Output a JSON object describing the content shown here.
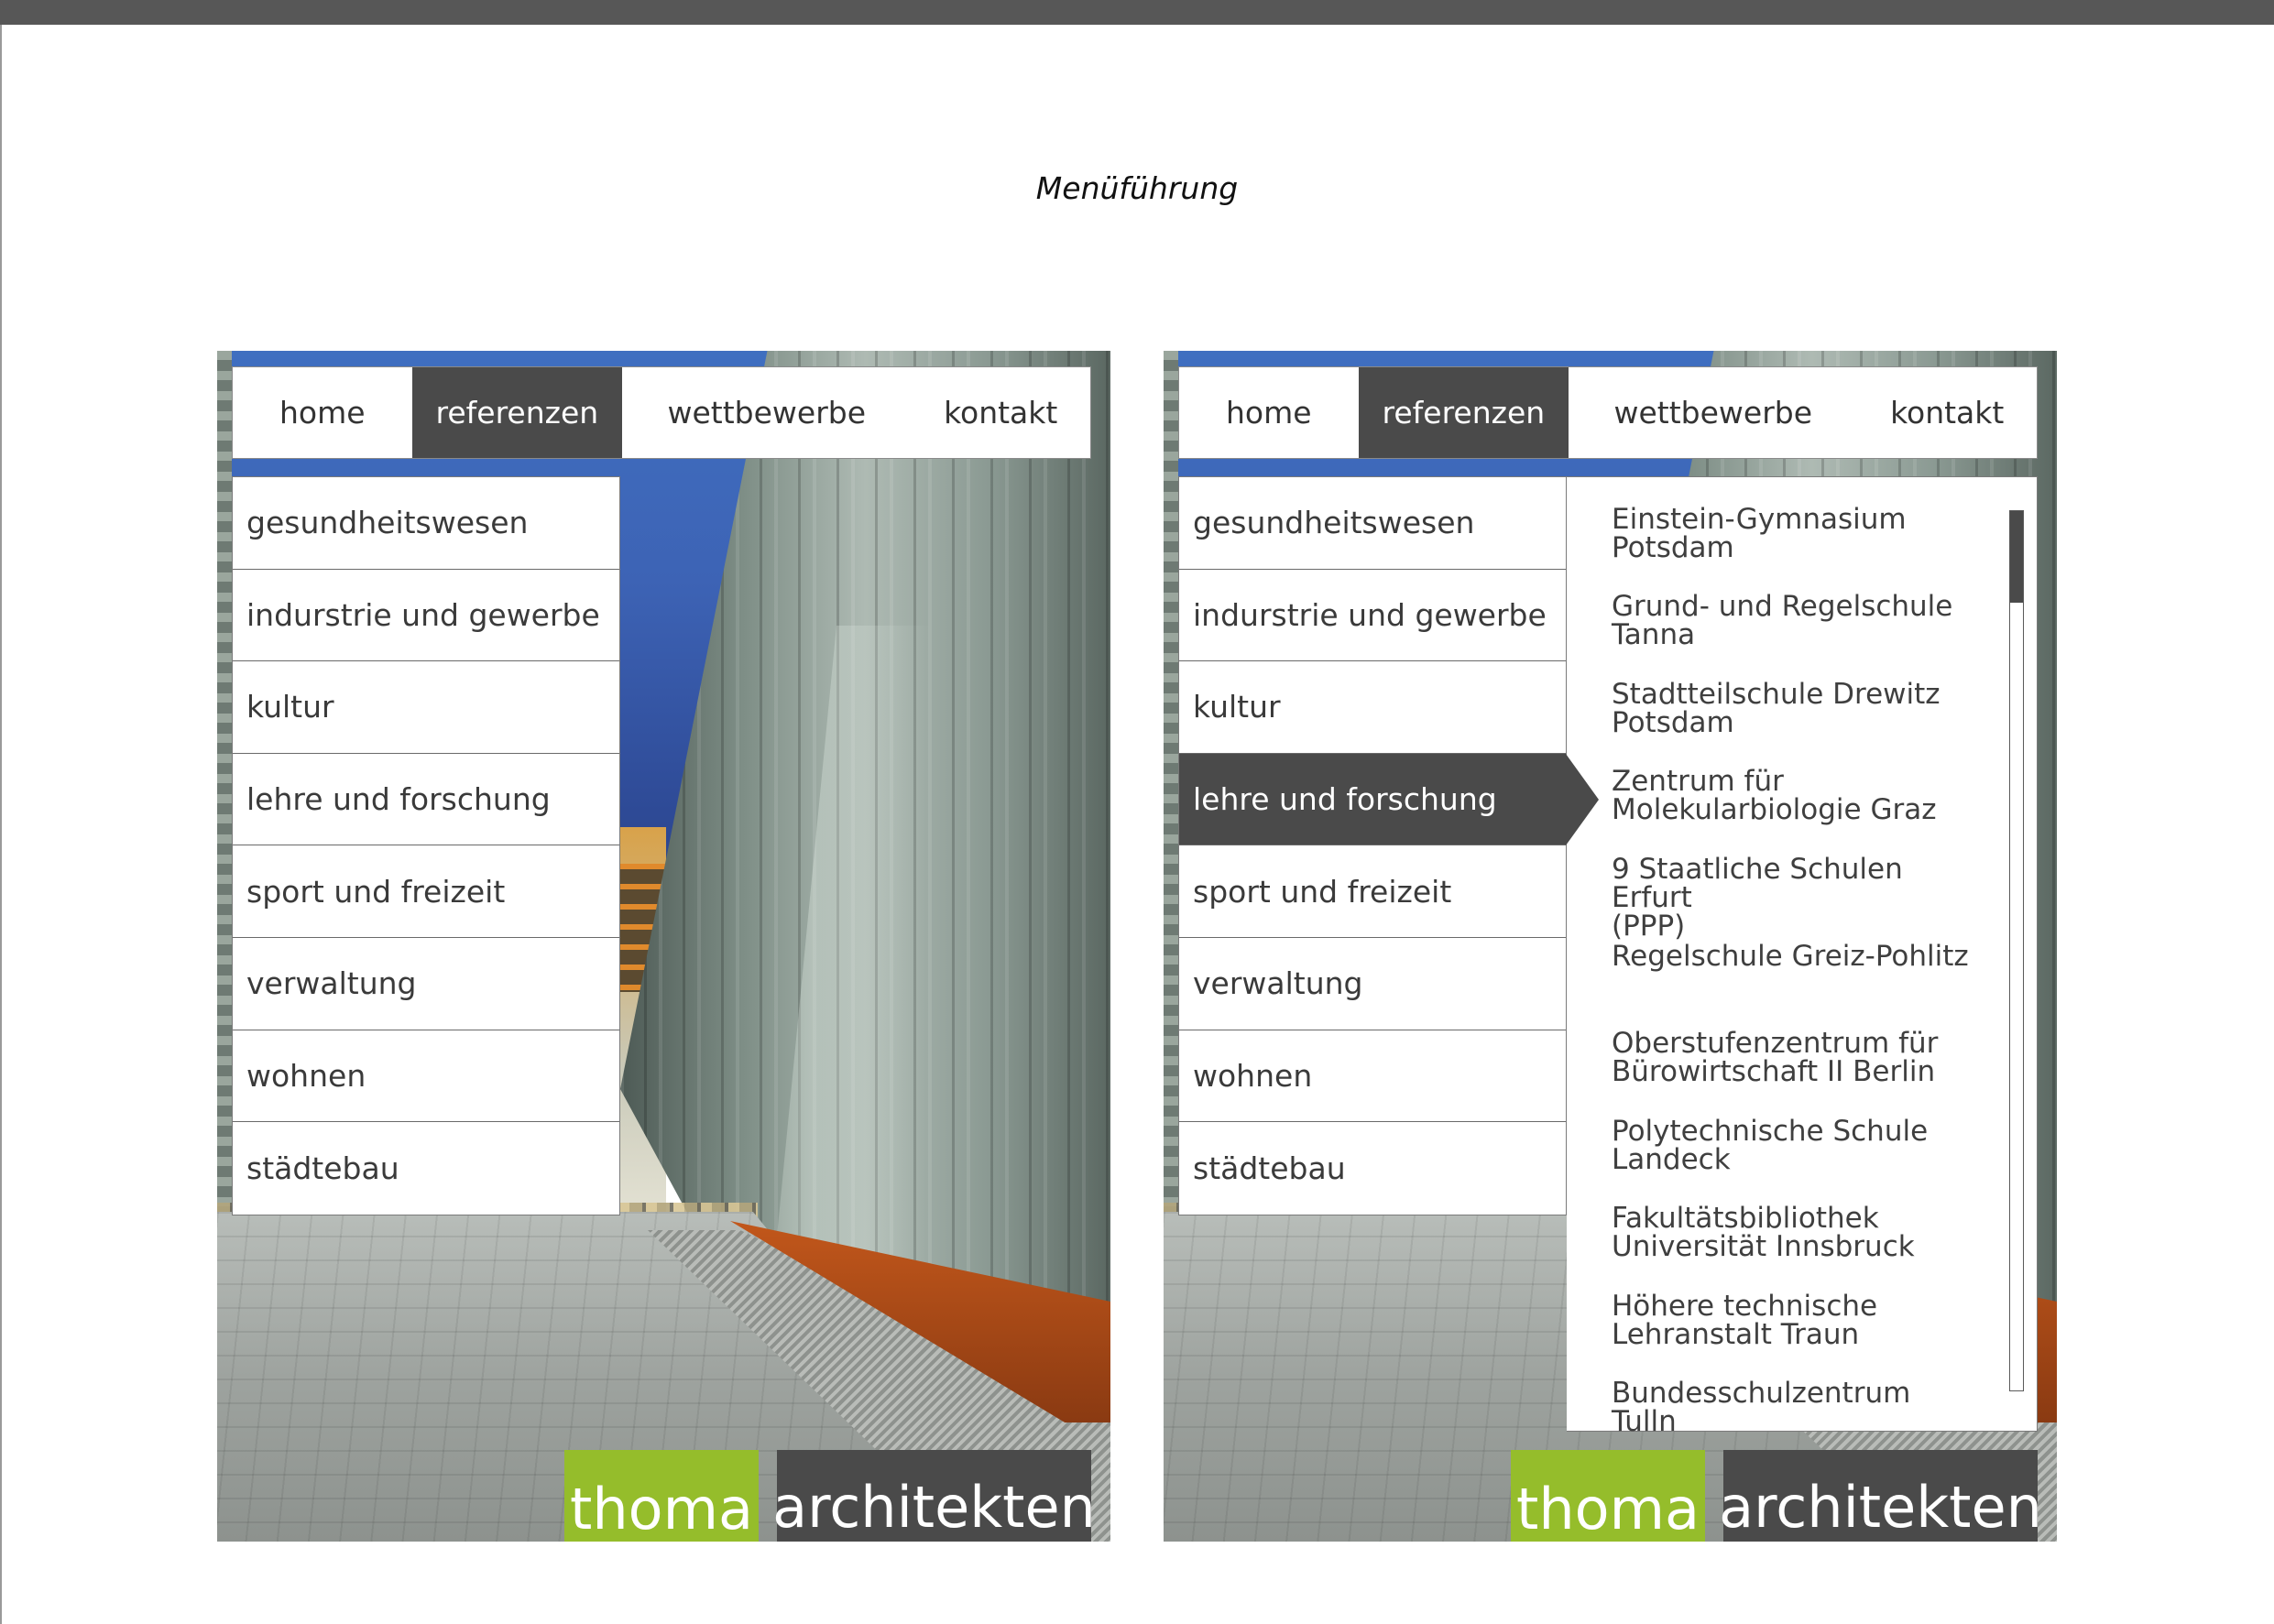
{
  "page": {
    "title": "Menüführung"
  },
  "nav": {
    "home": "home",
    "referenzen": "referenzen",
    "wettbewerbe": "wettbewerbe",
    "kontakt": "kontakt"
  },
  "submenu": {
    "items": [
      "gesundheitswesen",
      "indurstrie und gewerbe",
      "kultur",
      "lehre und forschung",
      "sport und freizeit",
      "verwaltung",
      "wohnen",
      "städtebau"
    ],
    "active_right": "lehre und forschung"
  },
  "projects": {
    "items": [
      [
        "Einstein-Gymnasium",
        "Potsdam"
      ],
      [
        "Grund- und Regelschule",
        "Tanna"
      ],
      [
        "Stadtteilschule Drewitz",
        "Potsdam"
      ],
      [
        "Zentrum für",
        "Molekularbiologie Graz"
      ],
      [
        "9 Staatliche Schulen Erfurt",
        "(PPP)"
      ],
      [
        "Regelschule Greiz-Pohlitz"
      ],
      [
        "Oberstufenzentrum für",
        "Bürowirtschaft II Berlin"
      ],
      [
        "Polytechnische Schule",
        "Landeck"
      ],
      [
        "Fakultätsbibliothek",
        "Universität Innsbruck"
      ],
      [
        "Höhere technische",
        "Lehranstalt Traun"
      ],
      [
        "Bundesschulzentrum Tulln"
      ]
    ]
  },
  "logo": {
    "part1": "thoma",
    "part2": "architekten"
  },
  "colors": {
    "accent_green": "#95bd2b",
    "dark_gray": "#4a4a4a",
    "top_bar": "#575757"
  }
}
